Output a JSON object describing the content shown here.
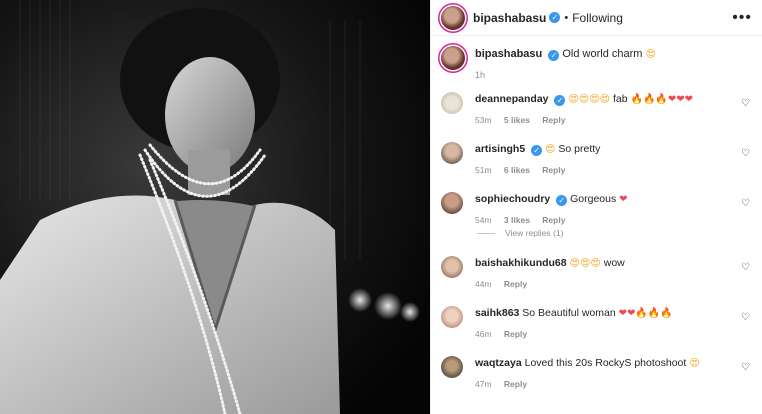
{
  "header": {
    "username": "bipashabasu",
    "separator": "•",
    "follow_status": "Following",
    "more_label": "•••"
  },
  "caption": {
    "username": "bipashabasu",
    "text": "Old world charm",
    "emoji": "😍",
    "time": "1h"
  },
  "comments": [
    {
      "username": "deannepanday",
      "text": "fab",
      "emoji_before": "😍😍😍😍",
      "emoji_after": "🔥🔥🔥❤❤❤",
      "time": "53m",
      "likes": "5 likes",
      "reply": "Reply",
      "verified": true
    },
    {
      "username": "artisingh5",
      "text": "So pretty",
      "emoji_before": "😍",
      "emoji_after": "",
      "time": "51m",
      "likes": "6 likes",
      "reply": "Reply",
      "verified": true
    },
    {
      "username": "sophiechoudry",
      "text": "Gorgeous",
      "emoji_before": "",
      "emoji_after": "❤",
      "time": "54m",
      "likes": "3 likes",
      "reply": "Reply",
      "verified": true
    },
    {
      "username": "baishakhikundu68",
      "text": "wow",
      "emoji_before": "😍😍😍",
      "emoji_after": "",
      "time": "44m",
      "likes": "",
      "reply": "Reply",
      "verified": false
    },
    {
      "username": "saihk863",
      "text": "So Beautiful woman",
      "emoji_before": "",
      "emoji_after": "❤❤🔥🔥🔥",
      "time": "46m",
      "likes": "",
      "reply": "Reply",
      "verified": false
    },
    {
      "username": "waqtzaya",
      "text": "Loved this 20s RockyS photoshoot",
      "emoji_before": "",
      "emoji_after": "😍",
      "time": "47m",
      "likes": "",
      "reply": "Reply",
      "verified": false
    }
  ],
  "view_replies": "View replies (1)",
  "icons": {
    "like": "heart-outline-icon",
    "verified": "verified-badge-icon",
    "more": "more-options-icon"
  },
  "colors": {
    "verified_blue": "#3897f0",
    "meta_gray": "#8e8e8e",
    "story_ring": "#d6249f"
  }
}
